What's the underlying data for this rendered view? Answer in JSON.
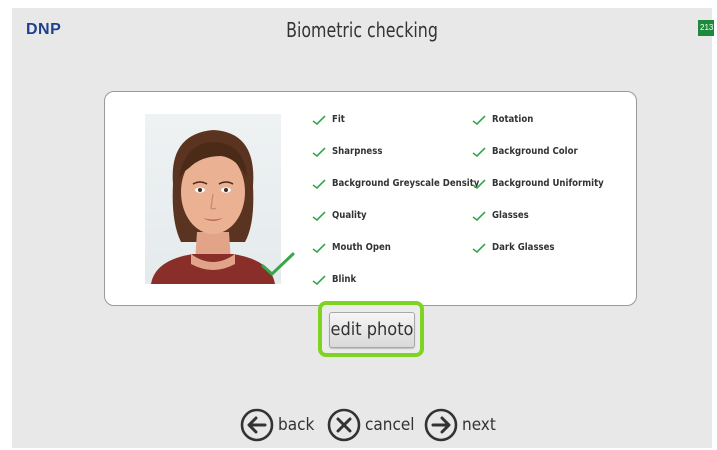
{
  "header": {
    "logo": "DNP",
    "title": "Biometric checking",
    "badge": "213"
  },
  "checks": [
    {
      "label": "Fit"
    },
    {
      "label": "Rotation"
    },
    {
      "label": "Sharpness"
    },
    {
      "label": "Background Color"
    },
    {
      "label": "Background Greyscale Density"
    },
    {
      "label": "Background Uniformity"
    },
    {
      "label": "Quality"
    },
    {
      "label": "Glasses"
    },
    {
      "label": "Mouth Open"
    },
    {
      "label": "Dark Glasses"
    },
    {
      "label": "Blink"
    }
  ],
  "actions": {
    "edit_photo": "edit photo"
  },
  "nav": {
    "back": "back",
    "cancel": "cancel",
    "next": "next"
  },
  "colors": {
    "highlight": "#7fd321",
    "check": "#3aa64a",
    "logo": "#1f3f8f"
  }
}
